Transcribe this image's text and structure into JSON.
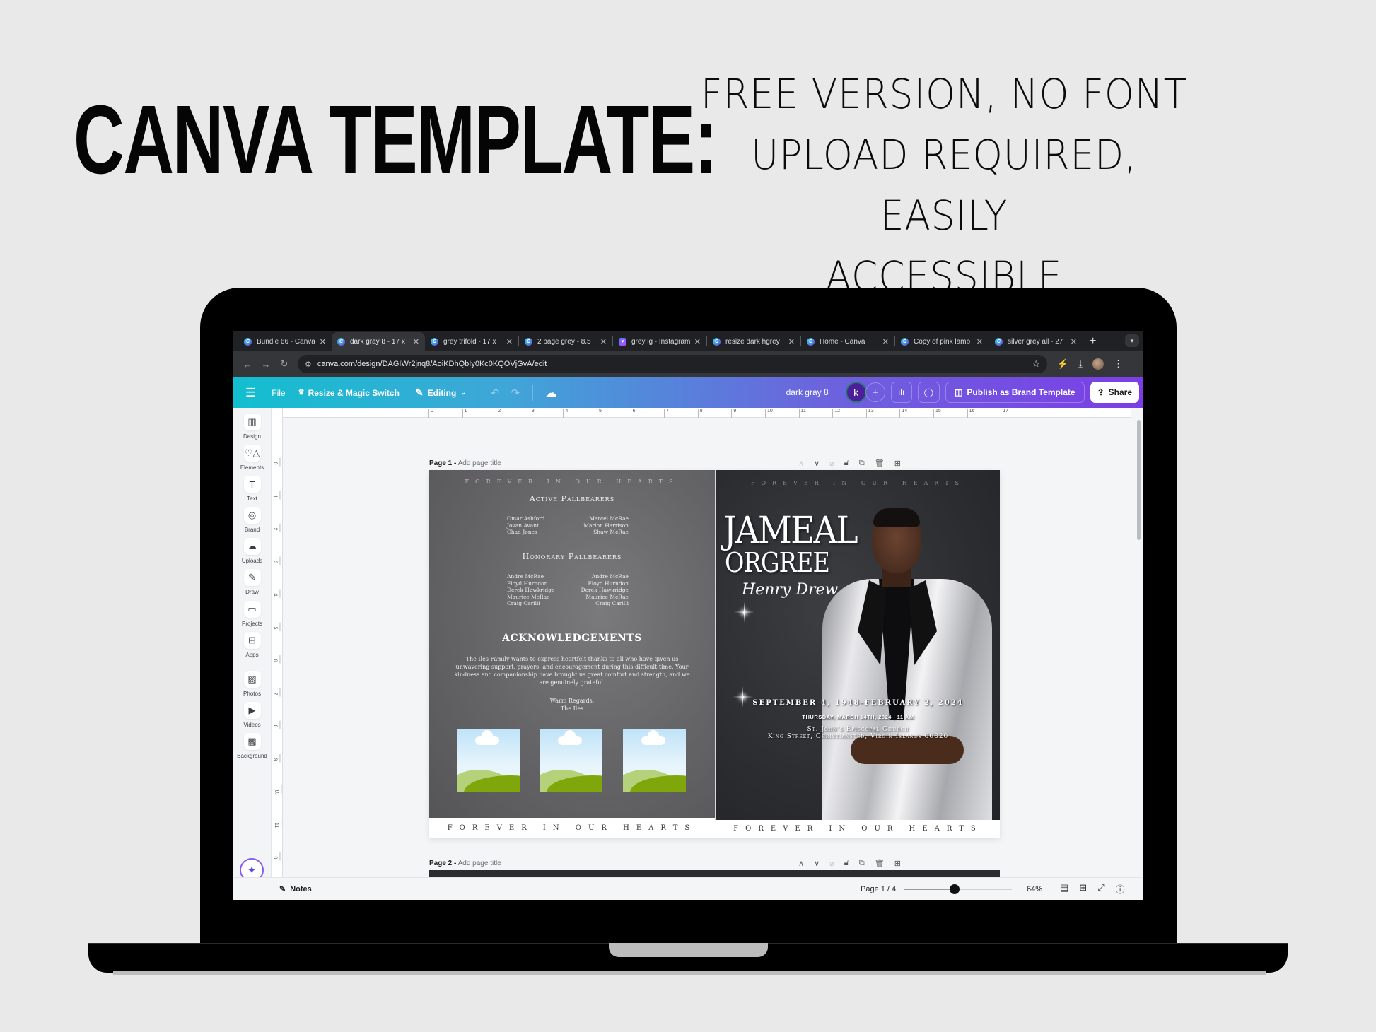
{
  "headline": {
    "left": "CANVA TEMPLATE:",
    "right_lines": [
      "FREE VERSION, NO FONT",
      "UPLOAD REQUIRED, EASILY",
      "ACCESSIBLE"
    ]
  },
  "browser": {
    "tabs": [
      {
        "label": "Bundle 66 - Canva",
        "icon": "canva-icon",
        "active": false
      },
      {
        "label": "dark gray 8 - 17 x",
        "icon": "canva-icon",
        "active": true
      },
      {
        "label": "grey trifold - 17 x",
        "icon": "canva-icon",
        "active": false
      },
      {
        "label": "2 page grey - 8.5",
        "icon": "canva-icon",
        "active": false
      },
      {
        "label": "grey ig - Instagram",
        "icon": "instagram-heart-icon",
        "active": false
      },
      {
        "label": "resize dark hgrey",
        "icon": "canva-icon",
        "active": false
      },
      {
        "label": "Home - Canva",
        "icon": "canva-icon",
        "active": false
      },
      {
        "label": "Copy of pink lamb",
        "icon": "canva-icon",
        "active": false
      },
      {
        "label": "silver grey all - 27",
        "icon": "canva-icon",
        "active": false
      }
    ],
    "new_tab": "+",
    "url": "canva.com/design/DAGIWr2jnq8/AoiKDhQbIy0Kc0KQOVjGvA/edit"
  },
  "toolbar": {
    "menu": "☰",
    "file": "File",
    "resize": "Resize & Magic Switch",
    "editing": "Editing",
    "doc_title": "dark gray 8",
    "avatar_initial": "k",
    "publish": "Publish as Brand Template",
    "share": "Share"
  },
  "sidebar": {
    "items": [
      {
        "label": "Design",
        "icon": "▥"
      },
      {
        "label": "Elements",
        "icon": "♡△"
      },
      {
        "label": "Text",
        "icon": "T"
      },
      {
        "label": "Brand",
        "icon": "◎"
      },
      {
        "label": "Uploads",
        "icon": "☁"
      },
      {
        "label": "Draw",
        "icon": "✎"
      },
      {
        "label": "Projects",
        "icon": "▭"
      },
      {
        "label": "Apps",
        "icon": "⊞"
      },
      {
        "label": "Photos",
        "icon": "▨"
      },
      {
        "label": "Videos",
        "icon": "▶"
      },
      {
        "label": "Background",
        "icon": "▩"
      }
    ]
  },
  "rulers": {
    "top": [
      "0",
      "1",
      "2",
      "3",
      "4",
      "5",
      "6",
      "7",
      "8",
      "9",
      "10",
      "11",
      "12",
      "13",
      "14",
      "15",
      "16",
      "17"
    ],
    "left": [
      "0",
      "1",
      "2",
      "3",
      "4",
      "5",
      "6",
      "7",
      "8",
      "9",
      "10",
      "11",
      "0"
    ]
  },
  "pages": [
    {
      "label": "Page 1 -",
      "placeholder": "Add page title"
    },
    {
      "label": "Page 2 -",
      "placeholder": "Add page title"
    }
  ],
  "design": {
    "tagline": "FOREVER IN OUR HEARTS",
    "left_panel": {
      "active_heading": "Active Pallbearers",
      "active_left": [
        "Omar Ashford",
        "Jovan Avant",
        "Chad Jones"
      ],
      "active_right": [
        "Marcel McRae",
        "Marlon Harrison",
        "Shaw McRae"
      ],
      "honorary_heading": "Honorary Pallbearers",
      "honorary_left": [
        "Andre McRae",
        "Floyd Hurndon",
        "Derek Hawkridge",
        "Maurice McRae",
        "Craig Carilli"
      ],
      "honorary_right": [
        "Andre McRae",
        "Floyd Hurndon",
        "Derek Hawkridge",
        "Maurice McRae",
        "Craig Carilli"
      ],
      "ack_heading": "ACKNOWLEDGEMENTS",
      "ack_body": "The Iles Family wants to express heartfelt thanks to all who have given us unwavering support, prayers, and encouragement during this difficult time. Your kindness and companionship have brought us great comfort and strength, and we are genuinely grateful.",
      "regards": "Warm Regards,",
      "signoff": "The Iles"
    },
    "right_panel": {
      "first_name": "JAMEAL",
      "last_name": "ORGREE",
      "middle_name": "Henry Drew",
      "dates": "SEPTEMBER 4, 1948-FEBRUARY 2, 2024",
      "service": "THURSDAY, MARCH 14TH, 2024 | 11 AM",
      "church": "St. John's Episcopal Church",
      "address": "King Street, Christiansted, Virgin Islands 00820"
    }
  },
  "bottombar": {
    "notes": "Notes",
    "page_count": "Page 1 / 4",
    "zoom_level": 64,
    "zoom_label": "64%"
  }
}
